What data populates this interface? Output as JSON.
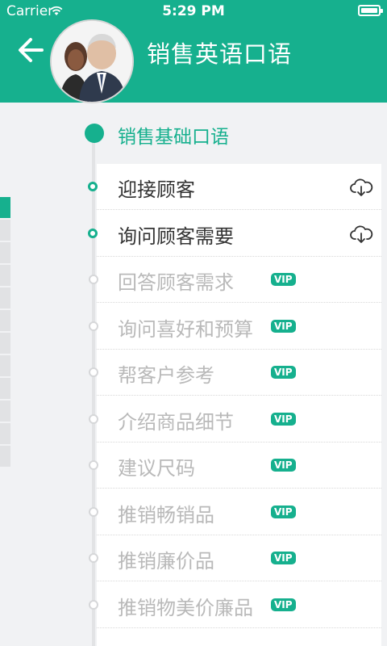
{
  "status_bar": {
    "carrier": "Carrier",
    "time": "5:29 PM"
  },
  "header": {
    "title": "销售英语口语",
    "back_icon": "back-arrow-icon",
    "background": "#16b08e"
  },
  "section": {
    "title": "销售基础口语"
  },
  "lessons": [
    {
      "label": "迎接顾客",
      "locked": false,
      "action": "cloud-download-icon"
    },
    {
      "label": "询问顾客需要",
      "locked": false,
      "action": "cloud-download-icon"
    },
    {
      "label": "回答顾客需求",
      "locked": true,
      "badge": "VIP"
    },
    {
      "label": "询问喜好和预算",
      "locked": true,
      "badge": "VIP"
    },
    {
      "label": "帮客户参考",
      "locked": true,
      "badge": "VIP"
    },
    {
      "label": "介绍商品细节",
      "locked": true,
      "badge": "VIP"
    },
    {
      "label": "建议尺码",
      "locked": true,
      "badge": "VIP"
    },
    {
      "label": "推销畅销品",
      "locked": true,
      "badge": "VIP"
    },
    {
      "label": "推销廉价品",
      "locked": true,
      "badge": "VIP"
    },
    {
      "label": "推销物美价廉品",
      "locked": true,
      "badge": "VIP"
    }
  ],
  "colors": {
    "accent": "#16b08e",
    "locked_text": "#b9b9b9"
  }
}
